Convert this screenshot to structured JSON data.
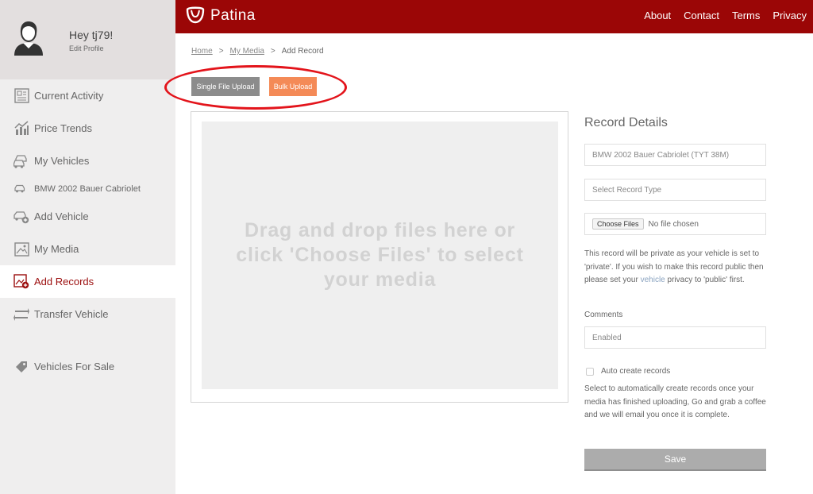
{
  "profile": {
    "greeting": "Hey tj79!",
    "edit_label": "Edit Profile"
  },
  "sidebar": {
    "items": [
      {
        "label": "Current Activity",
        "icon": "newspaper-icon"
      },
      {
        "label": "Price Trends",
        "icon": "bar-chart-icon"
      },
      {
        "label": "My Vehicles",
        "icon": "cars-icon"
      },
      {
        "label": "BMW 2002 Bauer Cabriolet",
        "icon": "car-icon"
      },
      {
        "label": "Add Vehicle",
        "icon": "add-car-icon"
      },
      {
        "label": "My Media",
        "icon": "image-icon"
      },
      {
        "label": "Add Records",
        "icon": "add-record-icon"
      },
      {
        "label": "Transfer Vehicle",
        "icon": "transfer-arrows-icon"
      },
      {
        "label": "Vehicles For Sale",
        "icon": "price-tag-icon"
      }
    ],
    "active_color": "#9b0d0d"
  },
  "header": {
    "logo_text": "Patina",
    "nav": [
      "About",
      "Contact",
      "Terms",
      "Privacy"
    ],
    "brand_color": "#9b0606"
  },
  "breadcrumb": {
    "home": "Home",
    "media": "My Media",
    "current": "Add Record",
    "separator": ">"
  },
  "upload_buttons": {
    "single": "Single File Upload",
    "bulk": "Bulk Upload",
    "bulk_color": "#f48a57"
  },
  "dropzone": {
    "text": "Drag and drop files here or click 'Choose Files' to select your media"
  },
  "record_details": {
    "title": "Record Details",
    "vehicle_placeholder": "BMW 2002 Bauer Cabriolet (TYT 38M)",
    "record_type_placeholder": "Select Record Type",
    "choose_files_label": "Choose Files",
    "no_file_label": "No file chosen",
    "privacy_note_part1": "This record will be private as your vehicle is set to 'private'. If you wish to make this record public then please set your ",
    "privacy_note_link": "vehicle",
    "privacy_note_part2": " privacy to 'public' first.",
    "comments_label": "Comments",
    "comments_value": "Enabled",
    "auto_create_label": "Auto create records",
    "auto_create_note": "Select to automatically create records once your media has finished uploading, Go and grab a coffee and we will email you once it is complete.",
    "save_label": "Save"
  }
}
